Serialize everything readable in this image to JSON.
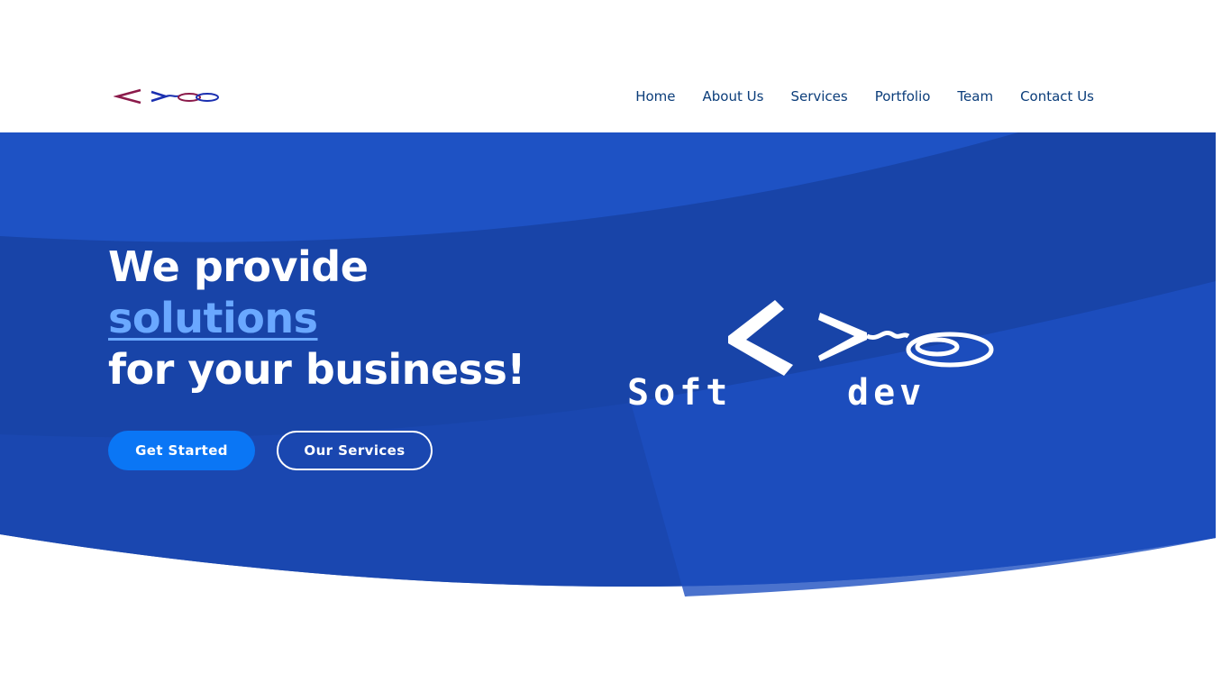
{
  "nav": {
    "items": [
      "Home",
      "About Us",
      "Services",
      "Portfolio",
      "Team",
      "Contact Us"
    ]
  },
  "hero": {
    "line1": "We provide",
    "highlight": "solutions",
    "line3": "for your business!",
    "primary_button": "Get Started",
    "secondary_button": "Our Services"
  },
  "logo": {
    "word1": "Soft",
    "word2": "dev"
  },
  "colors": {
    "nav_text": "#0b3d7a",
    "hero_bg": "#1a47b0",
    "highlight": "#6aa8ff",
    "primary_button": "#0a76f5"
  },
  "icons": {
    "logo_small": "code-brackets-mouse-logo",
    "logo_big": "code-brackets-mouse-logo"
  }
}
